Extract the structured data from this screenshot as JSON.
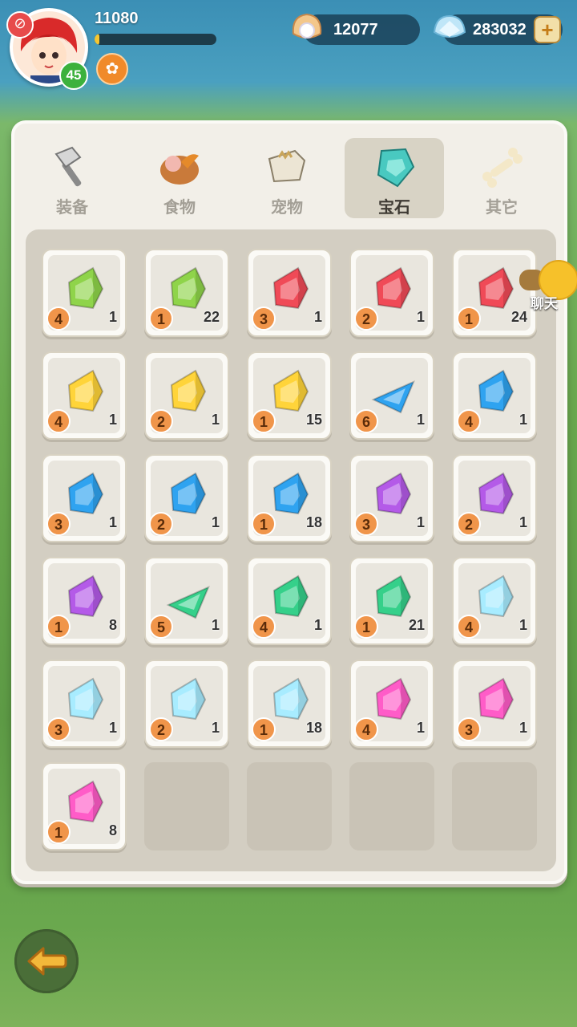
{
  "player": {
    "level": "45",
    "exp": "11080",
    "exp_progress": 0.04
  },
  "currency": {
    "pearls": "12077",
    "gems": "283032"
  },
  "tabs": [
    {
      "label": "装备",
      "icon": "hammer-icon",
      "active": false
    },
    {
      "label": "食物",
      "icon": "food-basket-icon",
      "active": false
    },
    {
      "label": "宠物",
      "icon": "pet-skull-icon",
      "active": false
    },
    {
      "label": "宝石",
      "icon": "gem-icon",
      "active": true
    },
    {
      "label": "其它",
      "icon": "bone-icon",
      "active": false
    }
  ],
  "chat_label": "聊天",
  "colors": {
    "lime": "#8fd44a",
    "red": "#f04a57",
    "yellow": "#ffd43a",
    "blue": "#2fa3f0",
    "purple": "#b45ae8",
    "green": "#35d08a",
    "ice": "#a8ecff",
    "pink": "#ff5cc8"
  },
  "items": [
    {
      "color": "lime",
      "grade": "4",
      "count": "1"
    },
    {
      "color": "lime",
      "grade": "1",
      "count": "22"
    },
    {
      "color": "red",
      "grade": "3",
      "count": "1"
    },
    {
      "color": "red",
      "grade": "2",
      "count": "1"
    },
    {
      "color": "red",
      "grade": "1",
      "count": "24"
    },
    {
      "color": "yellow",
      "grade": "4",
      "count": "1"
    },
    {
      "color": "yellow",
      "grade": "2",
      "count": "1"
    },
    {
      "color": "yellow",
      "grade": "1",
      "count": "15"
    },
    {
      "color": "blue",
      "grade": "6",
      "count": "1",
      "shape": "tri"
    },
    {
      "color": "blue",
      "grade": "4",
      "count": "1"
    },
    {
      "color": "blue",
      "grade": "3",
      "count": "1"
    },
    {
      "color": "blue",
      "grade": "2",
      "count": "1"
    },
    {
      "color": "blue",
      "grade": "1",
      "count": "18"
    },
    {
      "color": "purple",
      "grade": "3",
      "count": "1"
    },
    {
      "color": "purple",
      "grade": "2",
      "count": "1"
    },
    {
      "color": "purple",
      "grade": "1",
      "count": "8"
    },
    {
      "color": "green",
      "grade": "5",
      "count": "1",
      "shape": "tri"
    },
    {
      "color": "green",
      "grade": "4",
      "count": "1"
    },
    {
      "color": "green",
      "grade": "1",
      "count": "21"
    },
    {
      "color": "ice",
      "grade": "4",
      "count": "1"
    },
    {
      "color": "ice",
      "grade": "3",
      "count": "1"
    },
    {
      "color": "ice",
      "grade": "2",
      "count": "1"
    },
    {
      "color": "ice",
      "grade": "1",
      "count": "18"
    },
    {
      "color": "pink",
      "grade": "4",
      "count": "1"
    },
    {
      "color": "pink",
      "grade": "3",
      "count": "1"
    },
    {
      "color": "pink",
      "grade": "1",
      "count": "8"
    }
  ],
  "empty_slots": 4
}
